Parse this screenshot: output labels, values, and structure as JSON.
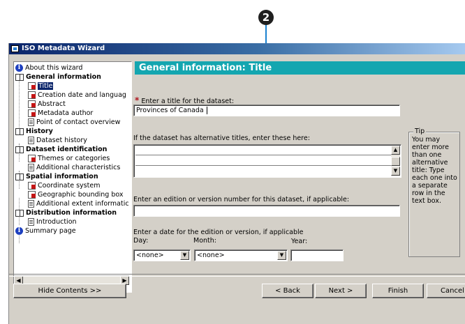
{
  "callout": {
    "number": "2"
  },
  "window": {
    "title": "ISO Metadata Wizard"
  },
  "tree": {
    "items": [
      {
        "label": "About this wizard"
      },
      {
        "label": "General information"
      },
      {
        "label": "Title"
      },
      {
        "label": "Creation date and languag"
      },
      {
        "label": "Abstract"
      },
      {
        "label": "Metadata author"
      },
      {
        "label": "Point of contact overview"
      },
      {
        "label": "History"
      },
      {
        "label": "Dataset history"
      },
      {
        "label": "Dataset identification"
      },
      {
        "label": "Themes or categories"
      },
      {
        "label": "Additional characteristics"
      },
      {
        "label": "Spatial information"
      },
      {
        "label": "Coordinate system"
      },
      {
        "label": "Geographic bounding box"
      },
      {
        "label": "Additional extent informatic"
      },
      {
        "label": "Distribution information"
      },
      {
        "label": "Introduction"
      },
      {
        "label": "Summary page"
      }
    ],
    "scroll_left": "◀",
    "scroll_right": "▶"
  },
  "main": {
    "header": "General information: Title",
    "title_label": "Enter a title for the dataset:",
    "title_required_mark": "*",
    "title_value": "Provinces of Canada",
    "alt_titles_label": "If the dataset has alternative titles, enter these here:",
    "edition_label": "Enter an edition or version number for this dataset, if applicable:",
    "edition_value": "",
    "date_label": "Enter a date for the edition or version, if applicable",
    "day_label": "Day:",
    "month_label": "Month:",
    "year_label": "Year:",
    "day_value": "<none>",
    "month_value": "<none>",
    "year_value": ""
  },
  "tip": {
    "title": "Tip",
    "text": "You may enter more than one alternative title: Type each one into a separate row in the text box."
  },
  "buttons": {
    "hide_contents": "Hide Contents >>",
    "back": "< Back",
    "next": "Next >",
    "finish": "Finish",
    "cancel": "Cancel"
  }
}
